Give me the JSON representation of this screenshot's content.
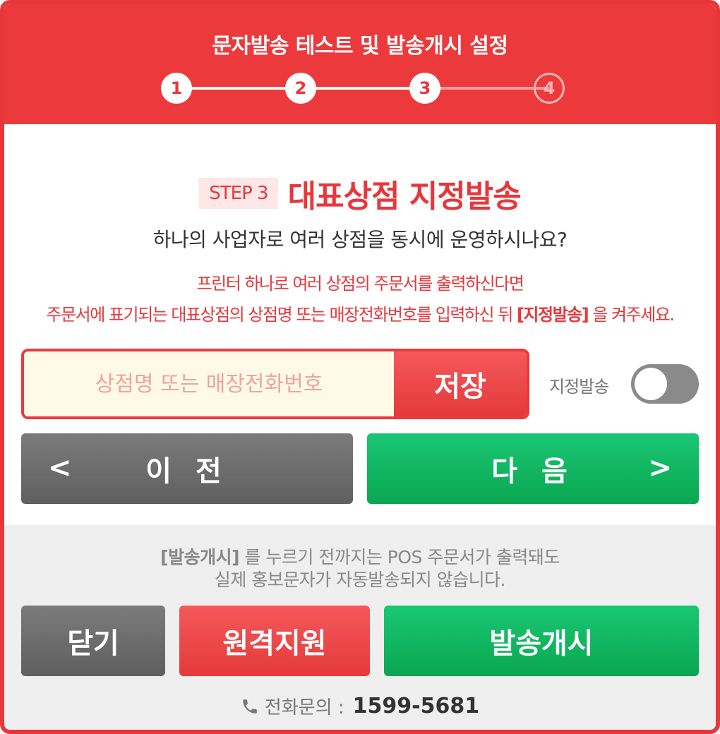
{
  "header": {
    "title": "문자발송 테스트 및 발송개시 설정",
    "steps": [
      "1",
      "2",
      "3",
      "4"
    ],
    "current_step": 3
  },
  "step": {
    "badge": "STEP 3",
    "title": "대표상점 지정발송"
  },
  "question": "하나의 사업자로 여러 상점을 동시에 운영하시나요?",
  "notice": {
    "line1": "프린터 하나로 여러 상점의 주문서를 출력하신다면",
    "line2_prefix": "주문서에 표기되는 대표상점의 상점명 또는 매장전화번호를 입력하신 뒤 ",
    "line2_bold": "[지정발송]",
    "line2_suffix": " 을 켜주세요."
  },
  "form": {
    "input_placeholder": "상점명 또는 매장전화번호",
    "input_value": "",
    "save_label": "저장",
    "toggle_label": "지정발송",
    "toggle_on": false
  },
  "nav": {
    "prev_label": "이 전",
    "next_label": "다 음",
    "prev_chevron": "<",
    "next_chevron": ">"
  },
  "footer": {
    "note_bold": "[발송개시]",
    "note_line1": " 를 누르기 전까지는 POS 주문서가 출력돼도",
    "note_line2": "실제 홍보문자가 자동발송되지 않습니다.",
    "close_label": "닫기",
    "remote_label": "원격지원",
    "start_label": "발송개시",
    "contact_label": "전화문의 :",
    "contact_number": "1599-5681"
  },
  "colors": {
    "brand_red": "#ec3a3c",
    "green": "#12b864",
    "gray": "#6f6f6f",
    "input_bg": "#fff9e8"
  },
  "icons": [
    "phone-icon",
    "chevron-left-icon",
    "chevron-right-icon"
  ]
}
